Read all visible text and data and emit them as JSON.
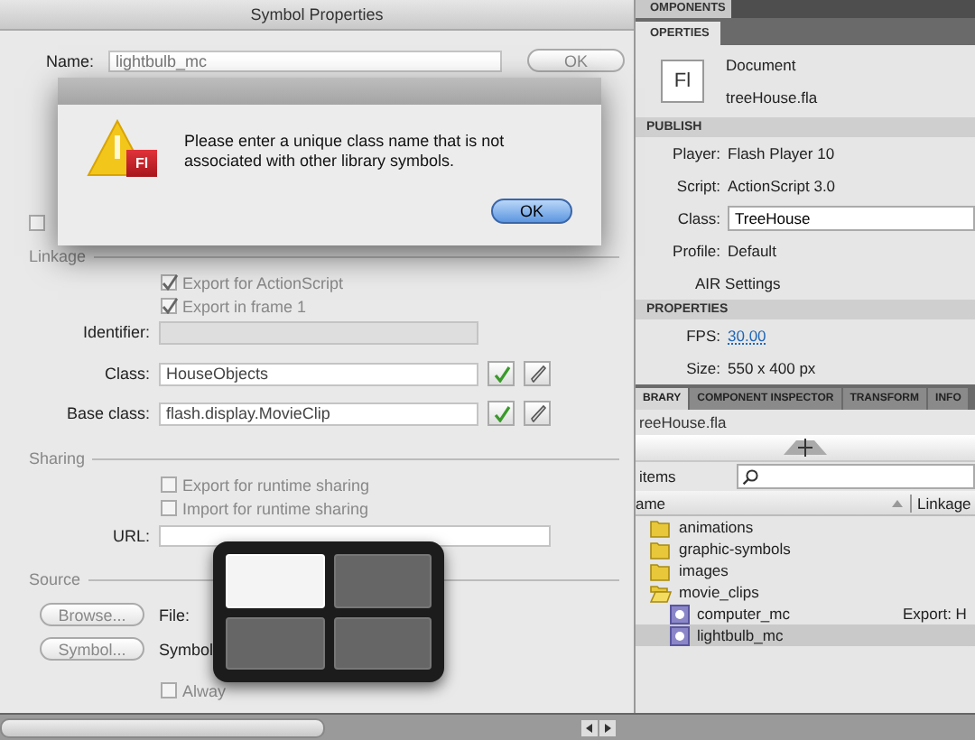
{
  "symbol_dialog": {
    "title": "Symbol Properties",
    "name_label": "Name:",
    "name_value": "lightbulb_mc",
    "ok_button": "OK",
    "partial_checkbox": {
      "checked": false
    },
    "linkage": {
      "heading": "Linkage",
      "checkboxes": [
        {
          "label": "Export for ActionScript",
          "checked": true
        },
        {
          "label": "Export in frame 1",
          "checked": true
        }
      ],
      "fields": [
        {
          "kind": "plain",
          "label": "Identifier:",
          "disabled": true
        },
        {
          "kind": "class",
          "label": "Class:",
          "value": "HouseObjects",
          "disabled": false
        },
        {
          "kind": "class",
          "label": "Base class:",
          "value": "flash.display.MovieClip",
          "disabled": false
        }
      ]
    },
    "sharing": {
      "heading": "Sharing",
      "checkboxes": [
        {
          "label": "Export for runtime sharing",
          "checked": false
        },
        {
          "label": "Import for runtime sharing",
          "checked": false
        }
      ],
      "url_label": "URL:"
    },
    "source": {
      "heading": "Source",
      "rows": [
        {
          "button": "Browse...",
          "text": "File:"
        },
        {
          "button": "Symbol...",
          "text": "Symbol"
        }
      ],
      "checkbox": {
        "label": "Alway",
        "checked": false
      }
    }
  },
  "alert": {
    "badge": "Fl",
    "message": "Please enter a unique class name that is not associated with other library symbols.",
    "button": "OK"
  },
  "workspace_switcher": {
    "tiles": [
      {
        "selected": true
      },
      {
        "selected": false
      },
      {
        "selected": false
      },
      {
        "selected": false
      }
    ]
  },
  "properties_panel": {
    "top_tab": "OMPONENTS",
    "tab": "OPERTIES",
    "document": {
      "icon_text": "Fl",
      "label": "Document",
      "file": "treeHouse.fla"
    },
    "sections": [
      {
        "heading": "PUBLISH",
        "rows": [
          {
            "kind": "text",
            "label": "Player:",
            "value": "Flash Player 10"
          },
          {
            "kind": "text",
            "label": "Script:",
            "value": "ActionScript 3.0"
          },
          {
            "kind": "field",
            "label": "Class:",
            "value": "TreeHouse"
          },
          {
            "kind": "text",
            "label": "Profile:",
            "value": "Default"
          },
          {
            "kind": "button",
            "label": "AIR Settings"
          }
        ]
      },
      {
        "heading": "PROPERTIES",
        "rows": [
          {
            "kind": "link",
            "label": "FPS:",
            "value": "30.00"
          },
          {
            "kind": "text",
            "label": "Size:",
            "value": "550 x 400 px"
          }
        ]
      }
    ]
  },
  "library_panel": {
    "tabs": [
      {
        "label": "BRARY",
        "selected": true
      },
      {
        "label": "COMPONENT INSPECTOR",
        "selected": false
      },
      {
        "label": "TRANSFORM",
        "selected": false
      },
      {
        "label": "INFO",
        "selected": false
      }
    ],
    "file": "reeHouse.fla",
    "item_count": "items",
    "columns": [
      "ame",
      "Linkage"
    ],
    "items": [
      {
        "kind": "folder",
        "name": "animations",
        "expanded": false,
        "selected": false
      },
      {
        "kind": "folder",
        "name": "graphic-symbols",
        "expanded": false,
        "selected": false
      },
      {
        "kind": "folder",
        "name": "images",
        "expanded": false,
        "selected": false
      },
      {
        "kind": "folder",
        "name": "movie_clips",
        "expanded": true,
        "selected": false,
        "children": [
          {
            "kind": "symbol",
            "name": "computer_mc",
            "linkage": "Export: H",
            "selected": false
          },
          {
            "kind": "symbol",
            "name": "lightbulb_mc",
            "selected": true
          }
        ]
      }
    ]
  }
}
